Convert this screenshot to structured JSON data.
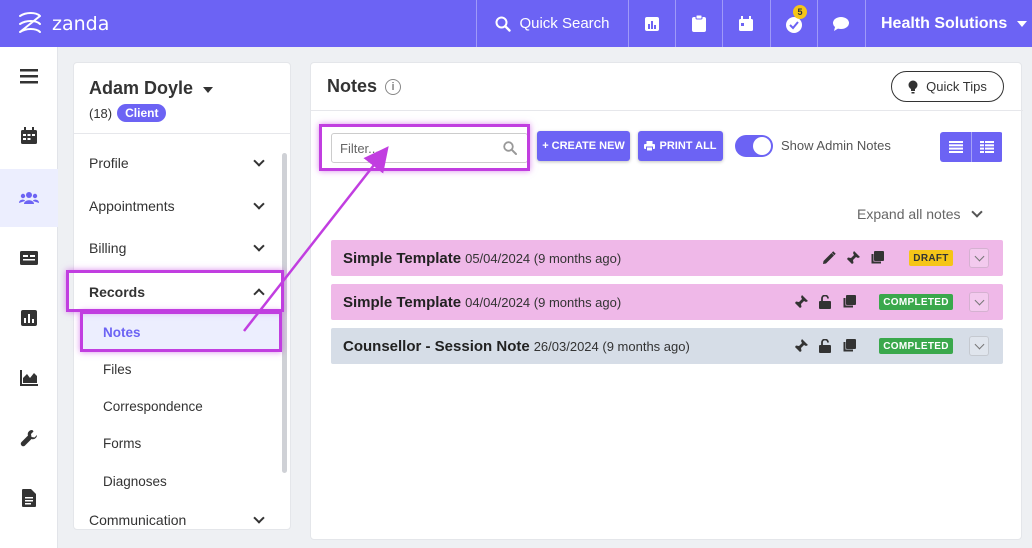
{
  "app": {
    "logo_text": "zanda"
  },
  "topbar": {
    "search_label": "Quick Search",
    "icons": [
      "reports-icon",
      "clipboard-icon",
      "calendar-icon",
      "tasks-icon",
      "chat-icon"
    ],
    "tasks_badge": "5",
    "org_name": "Health Solutions"
  },
  "rail": {
    "items": [
      "menu-icon",
      "calendar-icon",
      "clients-icon",
      "invoices-icon",
      "reports-icon",
      "analytics-icon",
      "settings-icon",
      "documents-icon"
    ],
    "active": "clients-icon"
  },
  "client": {
    "name": "Adam Doyle",
    "id": "(18)",
    "role": "Client",
    "nav": [
      {
        "label": "Profile",
        "state": "collapsed"
      },
      {
        "label": "Appointments",
        "state": "collapsed"
      },
      {
        "label": "Billing",
        "state": "collapsed"
      },
      {
        "label": "Records",
        "state": "expanded"
      },
      {
        "label": "Communication",
        "state": "collapsed"
      }
    ],
    "records_sub": [
      "Notes",
      "Files",
      "Correspondence",
      "Forms",
      "Diagnoses"
    ],
    "active_sub": "Notes"
  },
  "notes": {
    "title": "Notes",
    "quick_tips": "Quick Tips",
    "filter_placeholder": "Filter...",
    "create_new": "+ CREATE NEW",
    "print_all": "PRINT ALL",
    "show_admin_notes": "Show Admin Notes",
    "show_admin_notes_on": true,
    "expand_all": "Expand all notes",
    "rows": [
      {
        "title": "Simple Template",
        "date": "05/04/2024 (9 months ago)",
        "status": "DRAFT",
        "icons": [
          "edit-icon",
          "pin-icon",
          "copy-icon"
        ],
        "color": "#efb8e8"
      },
      {
        "title": "Simple Template",
        "date": "04/04/2024 (9 months ago)",
        "status": "COMPLETED",
        "icons": [
          "pin-icon",
          "unlock-icon",
          "copy-icon"
        ],
        "color": "#efb8e8"
      },
      {
        "title": "Counsellor - Session Note",
        "date": "26/03/2024 (9 months ago)",
        "status": "COMPLETED",
        "icons": [
          "pin-icon",
          "unlock-icon",
          "copy-icon"
        ],
        "color": "#d6dde7"
      }
    ]
  },
  "colors": {
    "brand": "#6c63f4",
    "annotation": "#c13ee0",
    "draft": "#f5c518",
    "completed": "#3aa84c"
  }
}
